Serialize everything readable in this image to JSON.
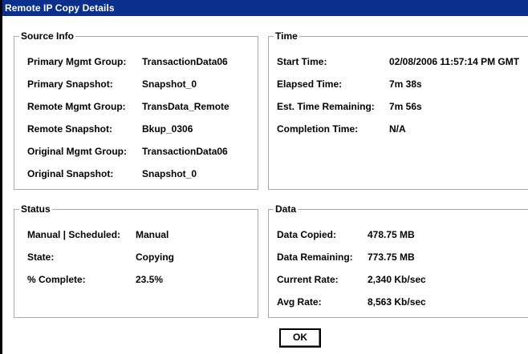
{
  "window": {
    "title": "Remote IP Copy Details"
  },
  "source_info": {
    "title": "Source Info",
    "rows": [
      {
        "label": "Primary Mgmt Group:",
        "value": "TransactionData06"
      },
      {
        "label": "Primary Snapshot:",
        "value": "Snapshot_0"
      },
      {
        "label": "Remote Mgmt Group:",
        "value": "TransData_Remote"
      },
      {
        "label": "Remote Snapshot:",
        "value": "Bkup_0306"
      },
      {
        "label": "Original Mgmt Group:",
        "value": "TransactionData06"
      },
      {
        "label": "Original Snapshot:",
        "value": "Snapshot_0"
      }
    ]
  },
  "time": {
    "title": "Time",
    "rows": [
      {
        "label": "Start Time:",
        "value": "02/08/2006 11:57:14 PM GMT"
      },
      {
        "label": "Elapsed Time:",
        "value": "7m 38s"
      },
      {
        "label": "Est. Time Remaining:",
        "value": "7m 56s"
      },
      {
        "label": "Completion Time:",
        "value": "N/A"
      }
    ]
  },
  "status": {
    "title": "Status",
    "rows": [
      {
        "label": "Manual | Scheduled:",
        "value": "Manual"
      },
      {
        "label": "State:",
        "value": "Copying"
      },
      {
        "label": "% Complete:",
        "value": "23.5%"
      }
    ]
  },
  "data": {
    "title": "Data",
    "rows": [
      {
        "label": "Data Copied:",
        "value": "478.75 MB"
      },
      {
        "label": "Data Remaining:",
        "value": "773.75 MB"
      },
      {
        "label": "Current Rate:",
        "value": "2,340 Kb/sec"
      },
      {
        "label": "Avg Rate:",
        "value": "8,563 Kb/sec"
      }
    ]
  },
  "buttons": {
    "ok_label": "OK"
  }
}
